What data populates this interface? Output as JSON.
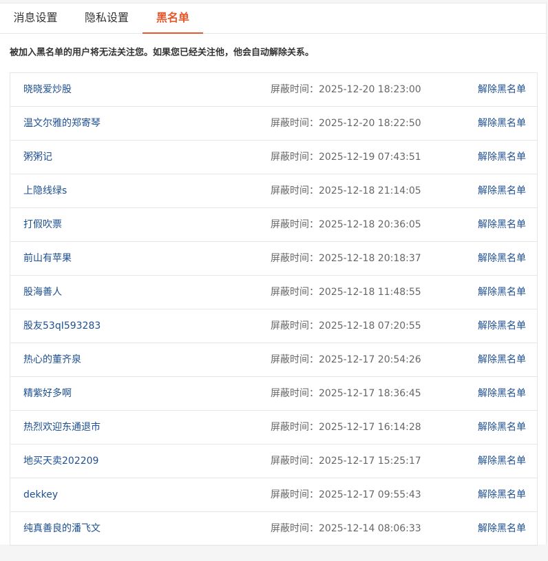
{
  "tabs": [
    {
      "label": "消息设置",
      "active": false
    },
    {
      "label": "隐私设置",
      "active": false
    },
    {
      "label": "黑名单",
      "active": true
    }
  ],
  "accent_color": "#e8562a",
  "link_color": "#1d4f91",
  "notice": "被加入黑名单的用户将无法关注您。如果您已经关注他，他会自动解除关系。",
  "time_prefix": "屏蔽时间：",
  "unblock_label": "解除黑名单",
  "blacklist": [
    {
      "name": "晓晓爱炒股",
      "time": "2025-12-20 18:23:00"
    },
    {
      "name": "温文尔雅的郑寄琴",
      "time": "2025-12-20 18:22:50"
    },
    {
      "name": "粥粥记",
      "time": "2025-12-19 07:43:51"
    },
    {
      "name": "上隐线绿s",
      "time": "2025-12-18 21:14:05"
    },
    {
      "name": "打假吹票",
      "time": "2025-12-18 20:36:05"
    },
    {
      "name": "前山有苹果",
      "time": "2025-12-18 20:18:37"
    },
    {
      "name": "股海善人",
      "time": "2025-12-18 11:48:55"
    },
    {
      "name": "股友53qI593283",
      "time": "2025-12-18 07:20:55"
    },
    {
      "name": "热心的董齐泉",
      "time": "2025-12-17 20:54:26"
    },
    {
      "name": "精紫好多啊",
      "time": "2025-12-17 18:36:45"
    },
    {
      "name": "热烈欢迎东通退市",
      "time": "2025-12-17 16:14:28"
    },
    {
      "name": "地买天卖202209",
      "time": "2025-12-17 15:25:17"
    },
    {
      "name": "dekkey",
      "time": "2025-12-17 09:55:43"
    },
    {
      "name": "纯真善良的潘飞文",
      "time": "2025-12-14 08:06:33"
    }
  ]
}
